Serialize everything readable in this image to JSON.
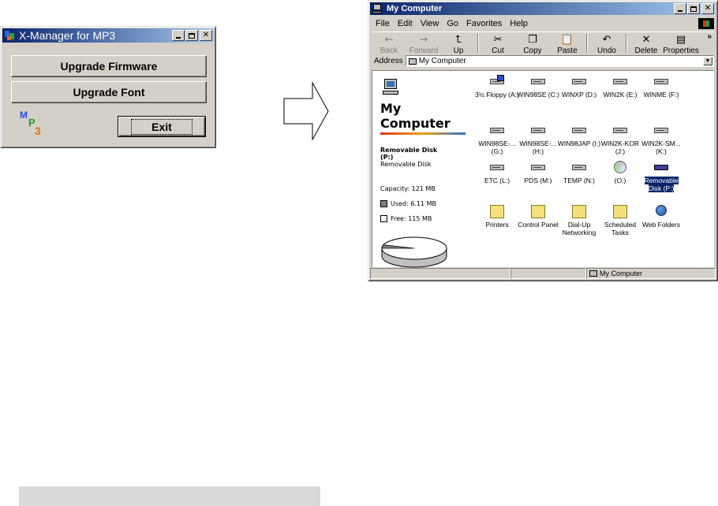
{
  "xmanager": {
    "title": "X-Manager for MP3",
    "buttons": {
      "upgrade_firmware": "Upgrade Firmware",
      "upgrade_font": "Upgrade Font",
      "exit": "Exit"
    },
    "logo": "MP3"
  },
  "explorer": {
    "title": "My Computer",
    "menu": [
      "File",
      "Edit",
      "View",
      "Go",
      "Favorites",
      "Help"
    ],
    "toolbar": [
      {
        "label": "Back",
        "icon": "back-arrow-icon",
        "enabled": false
      },
      {
        "label": "Forward",
        "icon": "forward-arrow-icon",
        "enabled": false
      },
      {
        "label": "Up",
        "icon": "up-folder-icon",
        "enabled": true
      },
      {
        "label": "Cut",
        "icon": "scissors-icon",
        "enabled": true
      },
      {
        "label": "Copy",
        "icon": "copy-icon",
        "enabled": true
      },
      {
        "label": "Paste",
        "icon": "paste-icon",
        "enabled": true
      },
      {
        "label": "Undo",
        "icon": "undo-icon",
        "enabled": true
      },
      {
        "label": "Delete",
        "icon": "delete-x-icon",
        "enabled": true
      },
      {
        "label": "Properties",
        "icon": "properties-icon",
        "enabled": true
      }
    ],
    "address_label": "Address",
    "address_value": "My Computer",
    "left_pane": {
      "heading_line1": "My",
      "heading_line2": "Computer",
      "selected_name": "Removable Disk",
      "selected_drive": "(P:)",
      "selected_type": "Removable Disk",
      "capacity": "Capacity: 121 MB",
      "used": "Used: 6.11 MB",
      "free": "Free: 115 MB"
    },
    "items": [
      {
        "label": "3½ Floppy (A:)",
        "kind": "floppy"
      },
      {
        "label": "WIN98SE (C:)",
        "kind": "drive"
      },
      {
        "label": "WINXP (D:)",
        "kind": "drive"
      },
      {
        "label": "WIN2K (E:)",
        "kind": "drive"
      },
      {
        "label": "WINME (F:)",
        "kind": "drive"
      },
      {
        "label": "WIN98SE-... (G:)",
        "kind": "drive"
      },
      {
        "label": "WIN98SE-... (H:)",
        "kind": "drive"
      },
      {
        "label": "WIN98JAP (I:)",
        "kind": "drive"
      },
      {
        "label": "WIN2K-KOR (J:)",
        "kind": "drive"
      },
      {
        "label": "WIN2K-SM... (K:)",
        "kind": "drive"
      },
      {
        "label": "ETC (L:)",
        "kind": "drive"
      },
      {
        "label": "PDS (M:)",
        "kind": "drive"
      },
      {
        "label": "TEMP (N:)",
        "kind": "drive"
      },
      {
        "label": "(O:)",
        "kind": "cdrom"
      },
      {
        "label": "Removable Disk (P:)",
        "kind": "removable",
        "selected": true
      },
      {
        "label": "Printers",
        "kind": "folder"
      },
      {
        "label": "Control Panel",
        "kind": "folder"
      },
      {
        "label": "Dial-Up Networking",
        "kind": "folder"
      },
      {
        "label": "Scheduled Tasks",
        "kind": "folder"
      },
      {
        "label": "Web Folders",
        "kind": "web"
      }
    ],
    "status": "My Computer",
    "used_fraction": 0.05
  }
}
